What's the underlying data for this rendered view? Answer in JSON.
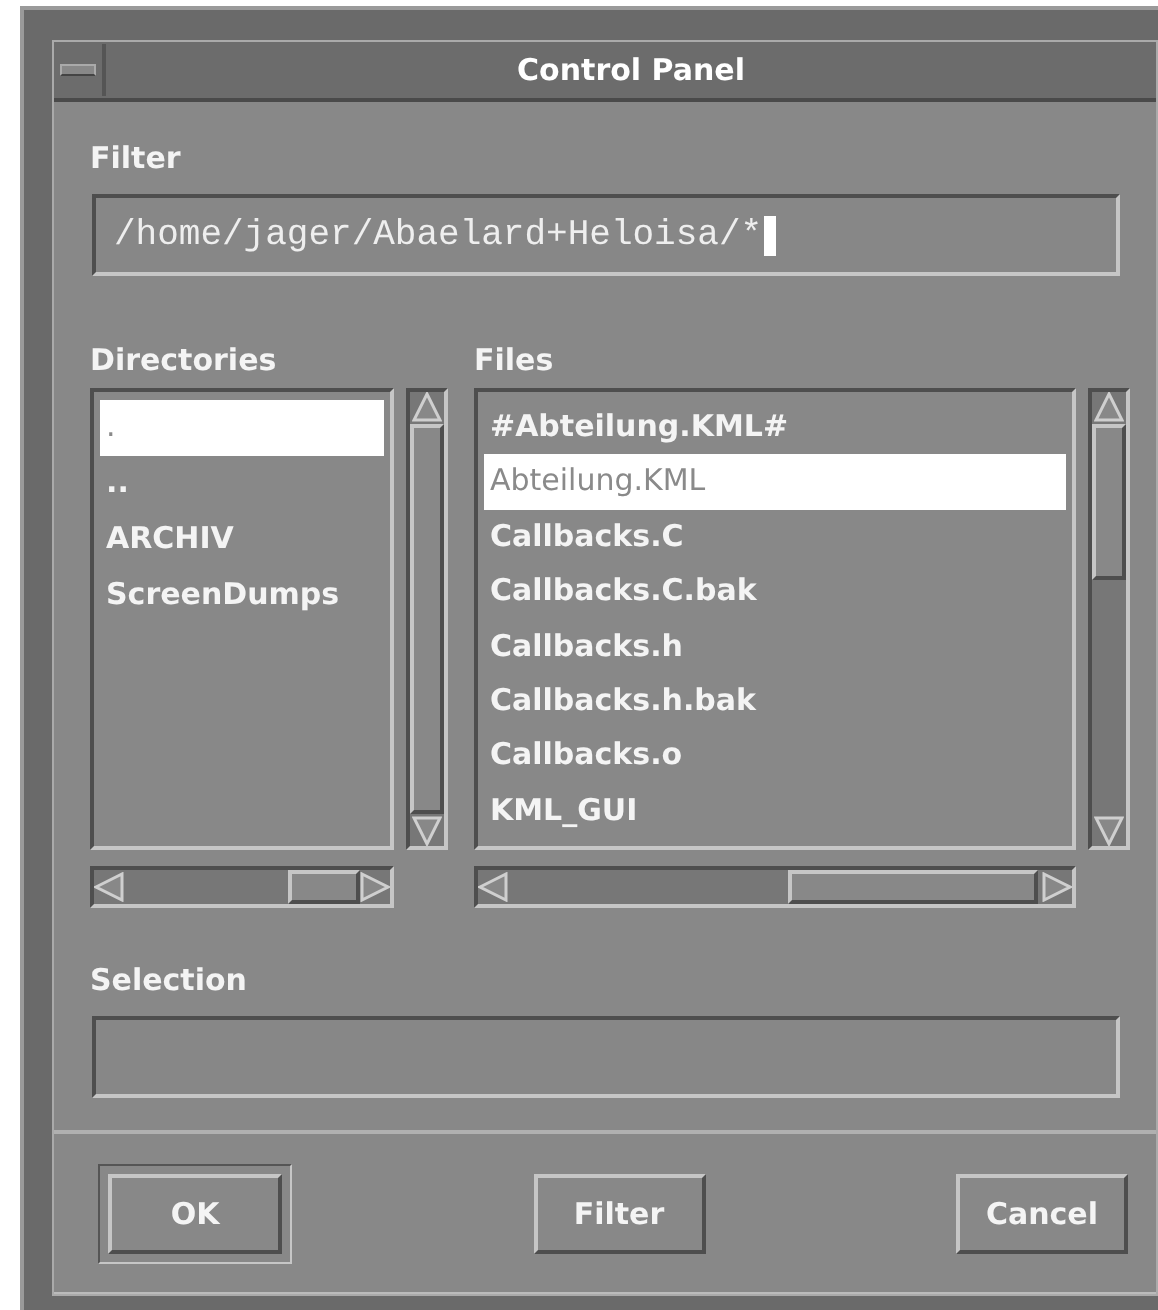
{
  "window": {
    "title": "Control Panel"
  },
  "filter": {
    "label": "Filter",
    "value": "/home/jager/Abaelard+Heloisa/*"
  },
  "directories": {
    "label": "Directories",
    "items": [
      {
        "name": ".",
        "selected": true
      },
      {
        "name": "..",
        "selected": false
      },
      {
        "name": "ARCHIV",
        "selected": false
      },
      {
        "name": "ScreenDumps",
        "selected": false
      }
    ]
  },
  "files": {
    "label": "Files",
    "items": [
      {
        "name": "#Abteilung.KML#",
        "selected": false
      },
      {
        "name": "Abteilung.KML",
        "selected": true
      },
      {
        "name": "Callbacks.C",
        "selected": false
      },
      {
        "name": "Callbacks.C.bak",
        "selected": false
      },
      {
        "name": "Callbacks.h",
        "selected": false
      },
      {
        "name": "Callbacks.h.bak",
        "selected": false
      },
      {
        "name": "Callbacks.o",
        "selected": false
      },
      {
        "name": "KML_GUI",
        "selected": false
      }
    ]
  },
  "selection": {
    "label": "Selection"
  },
  "buttons": [
    {
      "label": "OK",
      "default": true
    },
    {
      "label": "Filter",
      "default": false
    },
    {
      "label": "Cancel",
      "default": false
    }
  ]
}
